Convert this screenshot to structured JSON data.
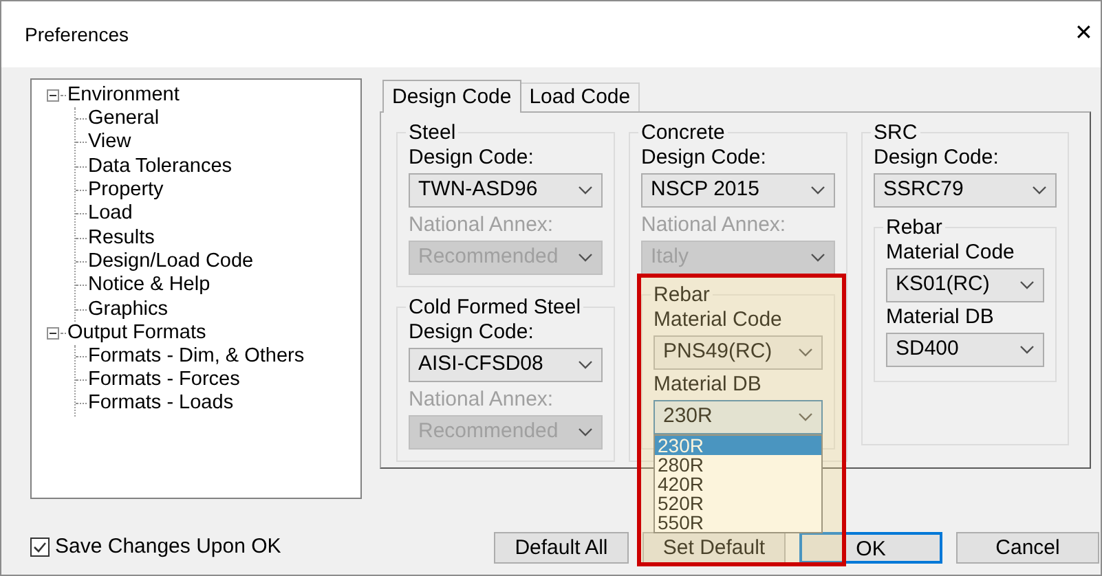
{
  "window": {
    "title": "Preferences",
    "close": "✕"
  },
  "tree": [
    {
      "label": "Environment",
      "expanded": true,
      "children": [
        {
          "label": "General"
        },
        {
          "label": "View"
        },
        {
          "label": "Data Tolerances"
        },
        {
          "label": "Property"
        },
        {
          "label": "Load"
        },
        {
          "label": "Results"
        },
        {
          "label": "Design/Load Code"
        },
        {
          "label": "Notice & Help"
        },
        {
          "label": "Graphics"
        }
      ]
    },
    {
      "label": "Output Formats",
      "expanded": true,
      "children": [
        {
          "label": "Formats - Dim, & Others"
        },
        {
          "label": "Formats - Forces"
        },
        {
          "label": "Formats - Loads"
        }
      ]
    }
  ],
  "tabs": [
    {
      "label": "Design Code",
      "selected": true
    },
    {
      "label": "Load Code",
      "selected": false
    }
  ],
  "columns": [
    [
      {
        "title": "Steel",
        "fields": [
          {
            "label": "Design Code:",
            "value": "TWN-ASD96",
            "disabled": false
          },
          {
            "label": "National Annex:",
            "value": "Recommended",
            "disabled": true
          }
        ]
      },
      {
        "title": "Cold Formed Steel",
        "fields": [
          {
            "label": "Design Code:",
            "value": "AISI-CFSD08",
            "disabled": false
          },
          {
            "label": "National Annex:",
            "value": "Recommended",
            "disabled": true
          }
        ]
      }
    ],
    [
      {
        "title": "Concrete",
        "fields": [
          {
            "label": "Design Code:",
            "value": "NSCP 2015",
            "disabled": false
          },
          {
            "label": "National Annex:",
            "value": "Italy",
            "disabled": true
          }
        ],
        "rebar": {
          "title": "Rebar",
          "fields": [
            {
              "label": "Material Code",
              "value": "PNS49(RC)",
              "disabled": false
            },
            {
              "label": "Material DB",
              "value": "230R",
              "disabled": false,
              "expanded": true,
              "options": [
                {
                  "label": "230R",
                  "selected": true
                },
                {
                  "label": "280R",
                  "selected": false
                },
                {
                  "label": "420R",
                  "selected": false
                },
                {
                  "label": "520R",
                  "selected": false
                },
                {
                  "label": "550R",
                  "selected": false
                }
              ]
            }
          ]
        }
      }
    ],
    [
      {
        "title": "SRC",
        "fields": [
          {
            "label": "Design Code:",
            "value": "SSRC79",
            "disabled": false
          }
        ],
        "rebar": {
          "title": "Rebar",
          "fields": [
            {
              "label": "Material Code",
              "value": "KS01(RC)",
              "disabled": false
            },
            {
              "label": "Material DB",
              "value": "SD400",
              "disabled": false
            }
          ]
        }
      }
    ]
  ],
  "annotation": {
    "kind": "highlight-box",
    "color": "#cc0000"
  },
  "save_option": {
    "label": "Save Changes Upon OK",
    "checked": true
  },
  "buttons": [
    {
      "label": "Default All",
      "focused": false
    },
    {
      "label": "Set Default",
      "focused": false
    },
    {
      "label": "OK",
      "focused": true
    },
    {
      "label": "Cancel",
      "focused": false
    }
  ]
}
